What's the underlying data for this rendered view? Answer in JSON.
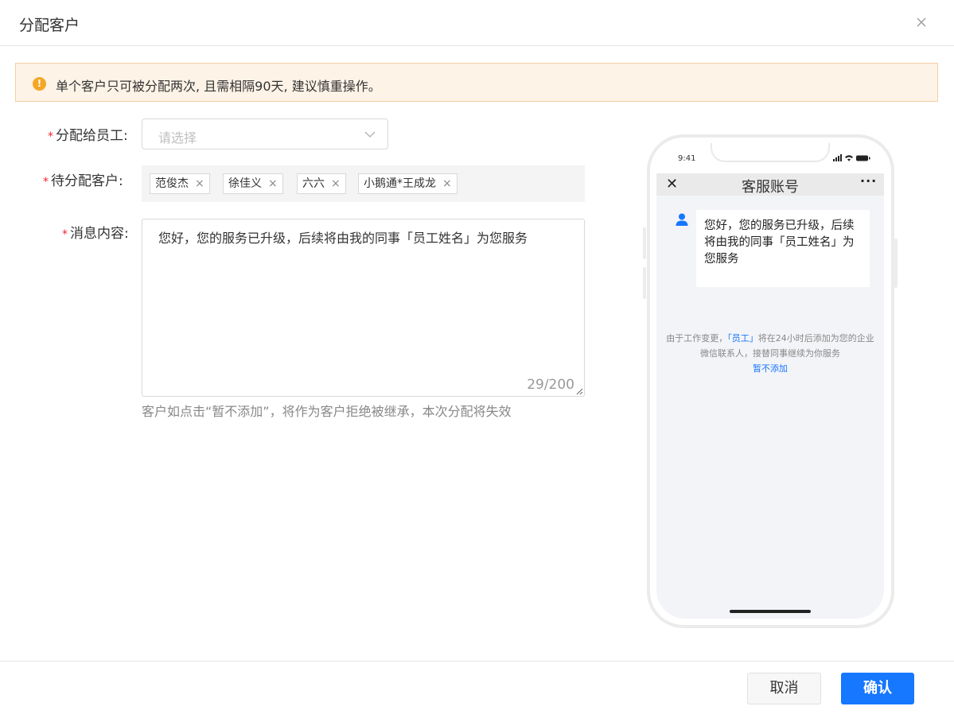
{
  "dialog": {
    "title": "分配客户"
  },
  "warning": {
    "text": "单个客户只可被分配两次, 且需相隔90天, 建议慎重操作。",
    "icon": "exclamation-icon",
    "icon_glyph": "!"
  },
  "form": {
    "assign_label": "分配给员工:",
    "assign_placeholder": "请选择",
    "customers_label": "待分配客户:",
    "customers": [
      {
        "name": "范俊杰"
      },
      {
        "name": "徐佳义"
      },
      {
        "name": "六六"
      },
      {
        "name": "小鹅通*王成龙"
      }
    ],
    "tag_close": "×",
    "message_label": "消息内容:",
    "message_value": "您好，您的服务已升级，后续将由我的同事「员工姓名」为您服务",
    "message_count": "29/200",
    "hint": "客户如点击“暂不添加”，将作为客户拒绝被继承，本次分配将失效",
    "required_mark": "*"
  },
  "phone": {
    "time": "9:41",
    "nav_back": "✕",
    "nav_title": "客服账号",
    "nav_more": "···",
    "message": "您好，您的服务已升级，后续将由我的同事「员工姓名」为您服务",
    "notice_prefix": "由于工作变更，",
    "notice_link": "「员工」",
    "notice_suffix": "将在24小时后添加为您的企业微信联系人，接替同事继续为你服务",
    "notice_action": "暂不添加"
  },
  "footer": {
    "cancel_label": "取消",
    "ok_label": "确认"
  },
  "colors": {
    "primary": "#1677ff",
    "warning": "#f5a623",
    "required": "#f5222d",
    "warning_bg": "#fdf3e7"
  }
}
